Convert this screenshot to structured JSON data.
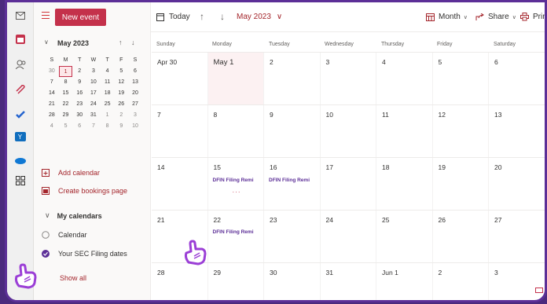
{
  "toolbar": {
    "new_event": "New event",
    "today": "Today",
    "month_label": "May 2023",
    "view": "Month",
    "share": "Share",
    "print": "Print"
  },
  "mini_calendar": {
    "title": "May 2023",
    "weekdays": [
      "S",
      "M",
      "T",
      "W",
      "T",
      "F",
      "S"
    ],
    "weeks": [
      [
        "30",
        "1",
        "2",
        "3",
        "4",
        "5",
        "6"
      ],
      [
        "7",
        "8",
        "9",
        "10",
        "11",
        "12",
        "13"
      ],
      [
        "14",
        "15",
        "16",
        "17",
        "18",
        "19",
        "20"
      ],
      [
        "21",
        "22",
        "23",
        "24",
        "25",
        "26",
        "27"
      ],
      [
        "28",
        "29",
        "30",
        "31",
        "1",
        "2",
        "3"
      ],
      [
        "4",
        "5",
        "6",
        "7",
        "8",
        "9",
        "10"
      ]
    ]
  },
  "sidebar": {
    "add_calendar": "Add calendar",
    "create_bookings": "Create bookings page",
    "my_calendars": "My calendars",
    "calendars": [
      "Calendar",
      "Your SEC Filing dates"
    ],
    "show_all": "Show all"
  },
  "month_view": {
    "weekdays": [
      "Sunday",
      "Monday",
      "Tuesday",
      "Wednesday",
      "Thursday",
      "Friday",
      "Saturday"
    ],
    "weeks": [
      [
        "Apr 30",
        "May 1",
        "2",
        "3",
        "4",
        "5",
        "6"
      ],
      [
        "7",
        "8",
        "9",
        "10",
        "11",
        "12",
        "13"
      ],
      [
        "14",
        "15",
        "16",
        "17",
        "18",
        "19",
        "20"
      ],
      [
        "21",
        "22",
        "23",
        "24",
        "25",
        "26",
        "27"
      ],
      [
        "28",
        "29",
        "30",
        "31",
        "Jun 1",
        "2",
        "3"
      ]
    ],
    "events": {
      "w2d1": "DFIN Filing Remi",
      "w2d2": "DFIN Filing Remi",
      "w2d1_more": "···",
      "w3d1": "DFIN Filing Remi"
    }
  },
  "colors": {
    "accent": "#c4314b",
    "event_text": "#5c2f97",
    "frame": "#5c2f97"
  }
}
